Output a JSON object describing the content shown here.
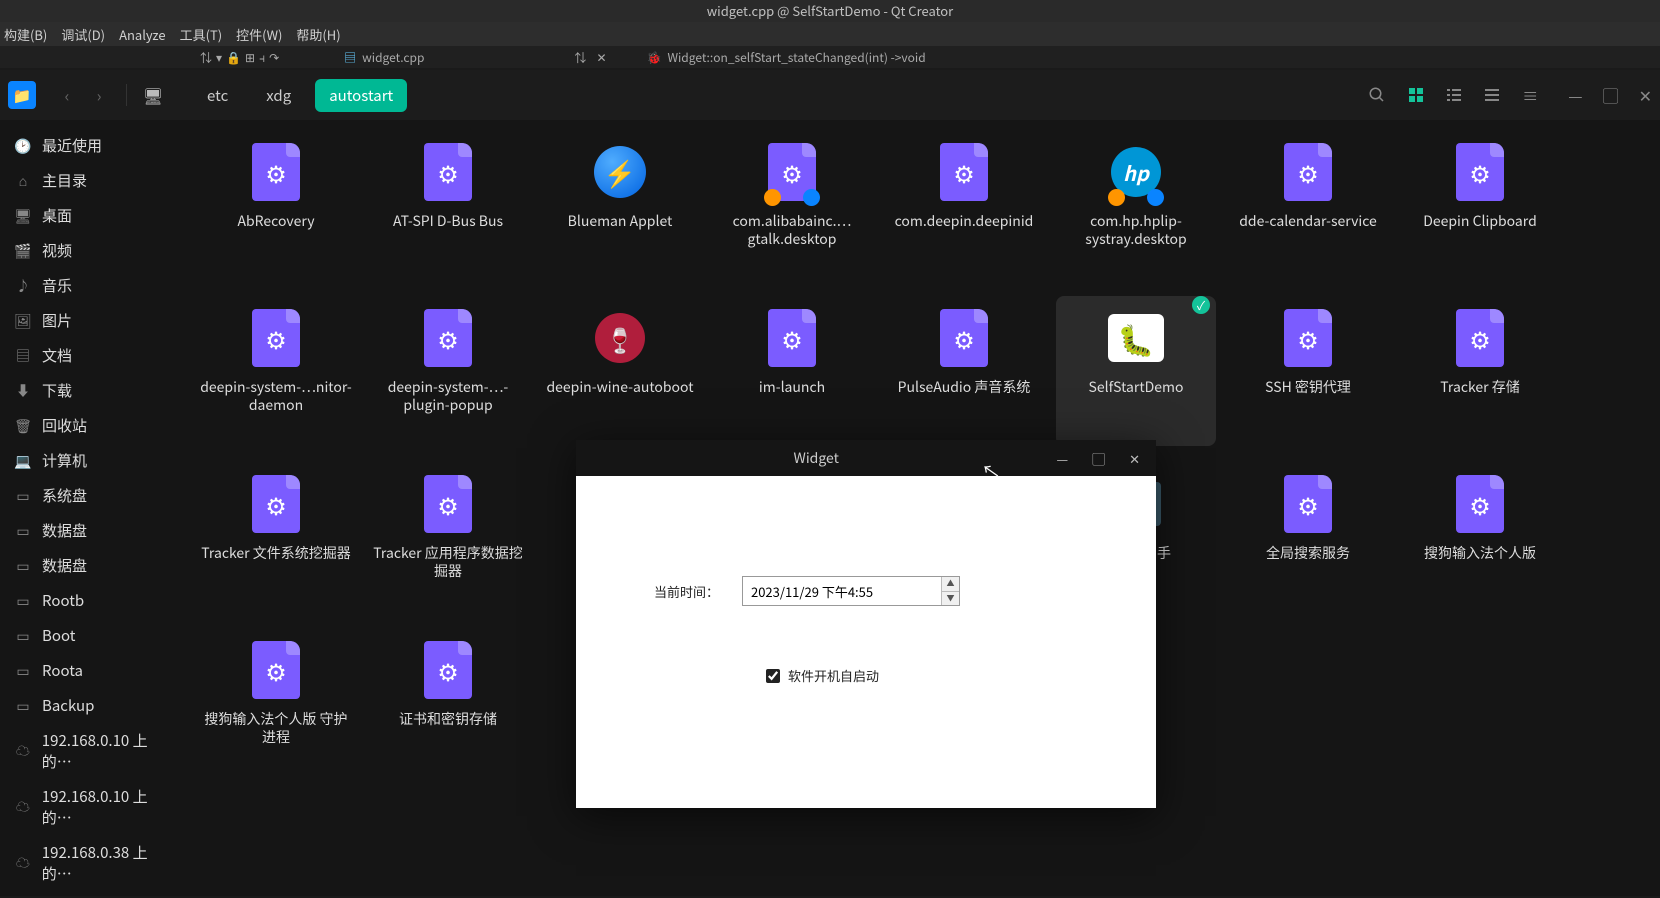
{
  "qt": {
    "title": "widget.cpp @ SelfStartDemo - Qt Creator",
    "menu": [
      "构建(B)",
      "调试(D)",
      "Analyze",
      "工具(T)",
      "控件(W)",
      "帮助(H)"
    ],
    "tab_file": "widget.cpp",
    "tab_context": "Widget::on_selfStart_stateChanged(int) ->void"
  },
  "fm": {
    "breadcrumb": [
      "etc",
      "xdg",
      "autostart"
    ]
  },
  "sidebar": [
    {
      "icon": "clock-icon",
      "label": "最近使用"
    },
    {
      "icon": "home-icon",
      "label": "主目录"
    },
    {
      "icon": "desktop-icon",
      "label": "桌面"
    },
    {
      "icon": "video-icon",
      "label": "视频"
    },
    {
      "icon": "music-icon",
      "label": "音乐"
    },
    {
      "icon": "picture-icon",
      "label": "图片"
    },
    {
      "icon": "document-icon",
      "label": "文档"
    },
    {
      "icon": "download-icon",
      "label": "下载"
    },
    {
      "icon": "trash-icon",
      "label": "回收站"
    },
    {
      "icon": "computer-icon",
      "label": "计算机"
    },
    {
      "icon": "disk-icon",
      "label": "系统盘"
    },
    {
      "icon": "disk-icon",
      "label": "数据盘"
    },
    {
      "icon": "disk-icon",
      "label": "数据盘"
    },
    {
      "icon": "disk-icon",
      "label": "Rootb"
    },
    {
      "icon": "disk-icon",
      "label": "Boot"
    },
    {
      "icon": "disk-icon",
      "label": "Roota"
    },
    {
      "icon": "disk-icon",
      "label": "Backup"
    },
    {
      "icon": "network-icon",
      "label": "192.168.0.10 上的…"
    },
    {
      "icon": "network-icon",
      "label": "192.168.0.10 上的…"
    },
    {
      "icon": "network-icon",
      "label": "192.168.0.38 上的…"
    }
  ],
  "files": [
    {
      "name": "AbRecovery",
      "icon": "gear"
    },
    {
      "name": "AT-SPI D-Bus Bus",
      "icon": "gear"
    },
    {
      "name": "Blueman Applet",
      "icon": "bluetooth"
    },
    {
      "name": "com.alibabainc.…gtalk.desktop",
      "icon": "gear",
      "overlays": [
        "orange",
        "blue"
      ]
    },
    {
      "name": "com.deepin.deepinid",
      "icon": "gear"
    },
    {
      "name": "com.hp.hplip-systray.desktop",
      "icon": "hp",
      "overlays": [
        "orange",
        "blue"
      ]
    },
    {
      "name": "dde-calendar-service",
      "icon": "gear"
    },
    {
      "name": "Deepin Clipboard",
      "icon": "gear"
    },
    {
      "name": "deepin-system-…nitor-daemon",
      "icon": "gear"
    },
    {
      "name": "deepin-system-…-plugin-popup",
      "icon": "gear"
    },
    {
      "name": "deepin-wine-autoboot",
      "icon": "wine"
    },
    {
      "name": "im-launch",
      "icon": "gear"
    },
    {
      "name": "PulseAudio 声音系统",
      "icon": "gear"
    },
    {
      "name": "SelfStartDemo",
      "icon": "bug",
      "selected": true,
      "check": true
    },
    {
      "name": "SSH 密钥代理",
      "icon": "gear"
    },
    {
      "name": "Tracker 存储",
      "icon": "gear"
    },
    {
      "name": "Tracker 文件系统挖掘器",
      "icon": "gear"
    },
    {
      "name": "Tracker 应用程序数据挖掘器",
      "icon": "gear"
    },
    {
      "name": "",
      "icon": "none"
    },
    {
      "name": "",
      "icon": "none"
    },
    {
      "name": "",
      "icon": "none"
    },
    {
      "name": "整理器助手",
      "icon": "printer"
    },
    {
      "name": "全局搜索服务",
      "icon": "gear"
    },
    {
      "name": "搜狗输入法个人版",
      "icon": "gear"
    },
    {
      "name": "搜狗输入法个人版 守护进程",
      "icon": "gear"
    },
    {
      "name": "证书和密钥存储",
      "icon": "gear"
    }
  ],
  "widget": {
    "title": "Widget",
    "time_label": "当前时间：",
    "time_value": "2023/11/29 下午4:55",
    "checkbox_label": "软件开机自启动",
    "checked": true
  }
}
